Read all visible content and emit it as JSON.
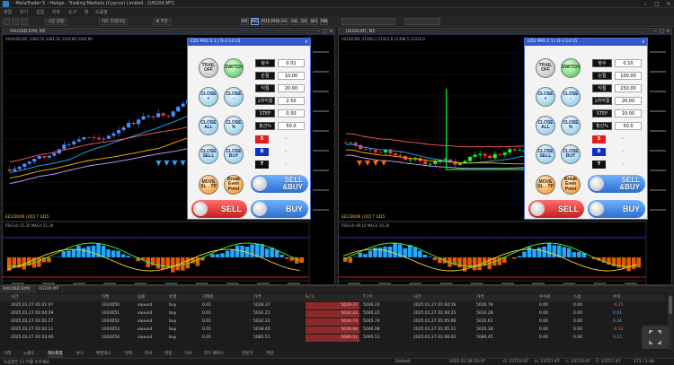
{
  "titlebar": {
    "title": "- MetaTrader 5 - Hedge - Trading Markets (Cyprus) Limited - [US100.MT]"
  },
  "menu": {
    "items": [
      "파일",
      "보기",
      "삽입",
      "차트",
      "도구",
      "창",
      "도움말"
    ]
  },
  "toolbar": {
    "buttons": [
      "시장 관찰",
      "차트 트레이딩",
      "새 주문"
    ],
    "timeframes": [
      "M1",
      "M5",
      "M15",
      "M30",
      "H1",
      "H4",
      "D1",
      "W1",
      "MN"
    ],
    "active_timeframe": "M5"
  },
  "charts": [
    {
      "window_title": "XAUUSD.SYM, M5",
      "sub_title": "XAUUSD,M5: 3360.50 3361.20 3359.80 3360.90",
      "indicator_label": "EZ3 DOOR | D15 T 1415",
      "osc_label": "RSI(14) 55.20 MA(3) 51.30",
      "arrow_color": "#22aaff",
      "bull_color": "#4a8cff",
      "bear_color": "#ff3333",
      "step_line_color": "#00ff3a"
    },
    {
      "window_title": "US100.MT, M5",
      "sub_title": "US100,M5: 21400.2 21412.8 21398.5 21410.0",
      "indicator_label": "EZ3 DOOR | D15 T 1415",
      "osc_label": "RSI(14) 48.10 MA(3) 50.20",
      "arrow_color": "#ff6a00",
      "bull_color": "#00ff3a",
      "bear_color": "#ff3333",
      "step_line_color": "#00ff3a"
    }
  ],
  "panels": [
    {
      "title": "EZU PRO 2.1 | D-3 14:15",
      "buttons": {
        "trail": "TRAIL\nOFF",
        "switch": "SWITCH",
        "close_plus": "CLOSE\n+",
        "close_minus": "CLOSE\n-",
        "close_all": "CLOSE\nALL",
        "close_pct": "CLOSE\n%",
        "close_sell": "CLOSE\nSELL",
        "close_buy": "CLOSE\nBUY",
        "move": "MOVE\nSL→TP",
        "breakeven": "Break\nEven\nPoint"
      },
      "rows": [
        {
          "label": "랏수",
          "value": "0.01"
        },
        {
          "label": "손절",
          "value": "10.00"
        },
        {
          "label": "익절",
          "value": "20.00"
        },
        {
          "label": "1차익절",
          "value": "2.50"
        },
        {
          "label": "STEP",
          "value": "0.50"
        },
        {
          "label": "청산%",
          "value": "50.0"
        }
      ],
      "signals": [
        {
          "label": "S",
          "value": "-",
          "color": "#e02020"
        },
        {
          "label": "B",
          "value": "-",
          "color": "#1030c0"
        },
        {
          "label": "T",
          "value": "-",
          "color": "#111111"
        }
      ],
      "sell_buy": "SELL\n&BUY",
      "sell": "SELL",
      "buy": "BUY"
    },
    {
      "title": "EZU PRO 2.1 | D-3 14:15",
      "buttons": {
        "trail": "TRAIL\nOFF",
        "switch": "SWITCH",
        "close_plus": "CLOSE\n+",
        "close_minus": "CLOSE\n-",
        "close_all": "CLOSE\nALL",
        "close_pct": "CLOSE\n%",
        "close_sell": "CLOSE\nSELL",
        "close_buy": "CLOSE\nBUY",
        "move": "MOVE\nSL→TP",
        "breakeven": "Break\nEven\nPoint"
      },
      "rows": [
        {
          "label": "랏수",
          "value": "0.10"
        },
        {
          "label": "손절",
          "value": "100.00"
        },
        {
          "label": "익절",
          "value": "150.00"
        },
        {
          "label": "1차익절",
          "value": "20.00"
        },
        {
          "label": "STEP",
          "value": "10.00"
        },
        {
          "label": "청산%",
          "value": "50.0"
        }
      ],
      "signals": [
        {
          "label": "S",
          "value": "-",
          "color": "#e02020"
        },
        {
          "label": "B",
          "value": "-",
          "color": "#1030c0"
        },
        {
          "label": "T",
          "value": "-",
          "color": "#111111"
        }
      ],
      "sell_buy": "SELL\n&BUY",
      "sell": "SELL",
      "buy": "BUY"
    }
  ],
  "terminal": {
    "symbol_tabs": [
      "XAUUSD.SYM",
      "US100.MT"
    ],
    "headers": [
      "시간",
      "티켓",
      "심볼",
      "유형",
      "거래량",
      "가격",
      "S / L",
      "T / P",
      "시간",
      "가격",
      "수수료",
      "스왑",
      "수익"
    ],
    "rows": [
      {
        "time": "2025.01.27 01:01:07",
        "ticket": "1024050",
        "symbol": "xauusd",
        "type": "buy",
        "volume": "0.01",
        "price": "5028.37",
        "sl": "5029.37",
        "tp": "5036.24",
        "ctime": "2025.01.27 01:04:16",
        "cprice": "5026.78",
        "commission": "0.00",
        "swap": "0.00",
        "profit": "-0.15"
      },
      {
        "time": "2025.01.27 01:04:29",
        "ticket": "1024051",
        "symbol": "xauusd",
        "type": "buy",
        "volume": "0.01",
        "price": "5032.21",
        "sl": "5032.22",
        "tp": "5040.22",
        "ctime": "2025.01.27 01:04:25",
        "cprice": "5032.28",
        "commission": "0.00",
        "swap": "0.00",
        "profit": "0.01"
      },
      {
        "time": "2025.01.27 01:01:27",
        "ticket": "1024052",
        "symbol": "xauusd",
        "type": "buy",
        "volume": "0.01",
        "price": "5032.22",
        "sl": "5034.74",
        "tp": "5045.74",
        "ctime": "2025.01.27 01:05:06",
        "cprice": "5035.61",
        "commission": "0.00",
        "swap": "0.00",
        "profit": "0.34"
      },
      {
        "time": "2025.01.27 01:02:11",
        "ticket": "1024053",
        "symbol": "xauusd",
        "type": "buy",
        "volume": "0.01",
        "price": "5038.40",
        "sl": "5036.08",
        "tp": "5046.08",
        "ctime": "2025.01.27 01:05:11",
        "cprice": "5035.18",
        "commission": "0.00",
        "swap": "0.00",
        "profit": "-0.32"
      },
      {
        "time": "2025.01.27 01:03:40",
        "ticket": "1024054",
        "symbol": "xauusd",
        "type": "buy",
        "volume": "0.01",
        "price": "5085.51",
        "sl": "5089.51",
        "tp": "5095.51",
        "ctime": "2025.01.27 01:06:02",
        "cprice": "5086.45",
        "commission": "0.00",
        "swap": "0.00",
        "profit": "0.15"
      }
    ],
    "bottom_tabs": [
      "거래",
      "노출도",
      "히스토리",
      "뉴스",
      "메일박스",
      "달력",
      "회사",
      "알림",
      "기사",
      "코드 베이스",
      "전문가",
      "저널"
    ],
    "status": {
      "left": "도움말은 F1 키를 누르세요",
      "profile": "Default",
      "datetime": "2025.01.28 23:47",
      "o": "O: 23753.07",
      "h": "H: 23757.47",
      "l": "L: 23753.07",
      "c": "C: 23757.47",
      "ping": "171 / 1 kb"
    }
  }
}
